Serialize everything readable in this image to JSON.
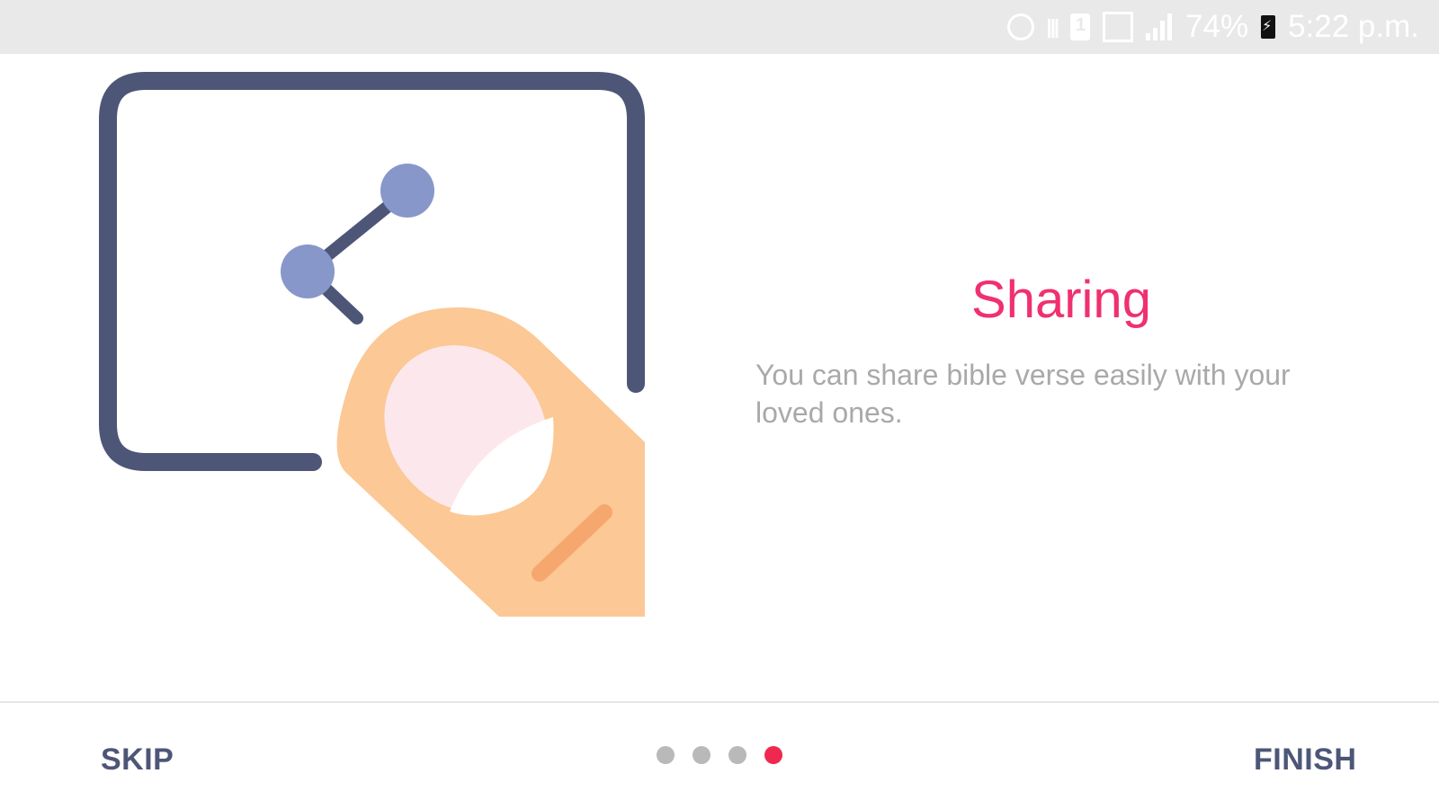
{
  "status_bar": {
    "battery_percent": "74%",
    "time": "5:22 p.m.",
    "icons": [
      "alarm-icon",
      "vibrate-icon",
      "sim-icon",
      "no-signal-icon",
      "signal-icon",
      "battery-charging-icon"
    ]
  },
  "slide": {
    "illustration": "tap-share-illustration",
    "title": "Sharing",
    "description": "You can share bible verse easily with your loved ones."
  },
  "navigation": {
    "skip_label": "SKIP",
    "finish_label": "FINISH",
    "page_count": 4,
    "active_page": 4
  },
  "colors": {
    "accent": "#f0306f",
    "active_dot": "#f0284f",
    "inactive_dot": "#b9b9b9",
    "button_text": "#4d5677",
    "frame": "#4d5677",
    "share_nodes": "#8797c9",
    "finger": "#fbc896",
    "nail": "#fce8ec"
  }
}
